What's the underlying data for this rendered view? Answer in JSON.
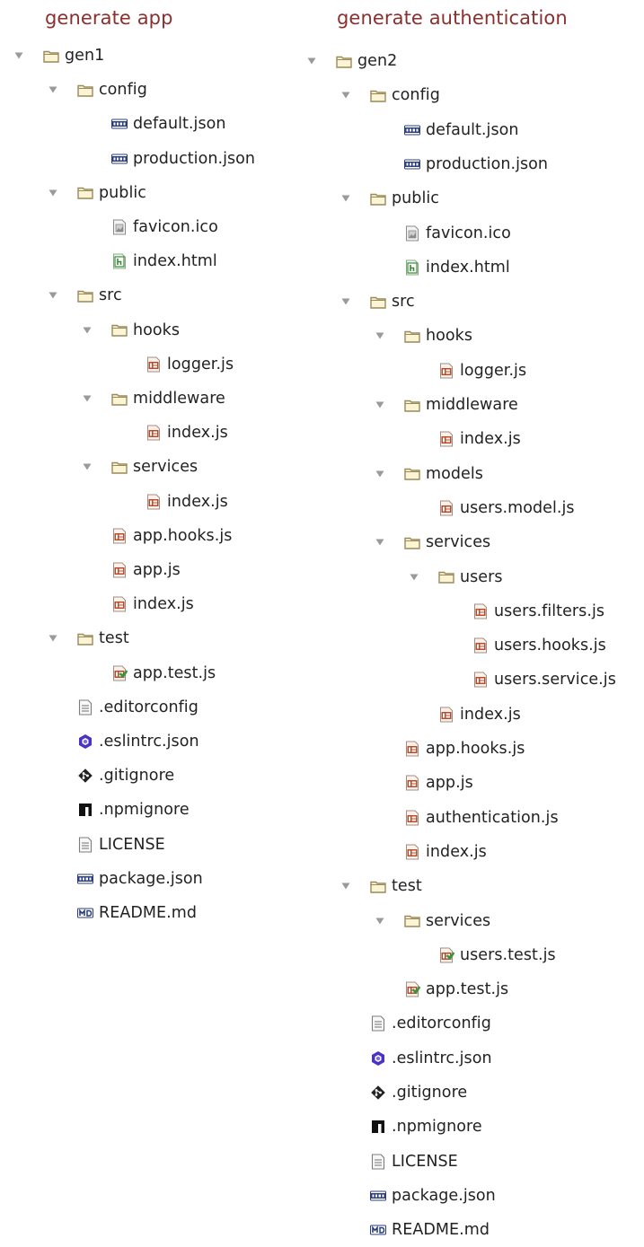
{
  "icons": {
    "twisty_open": "triangle-down-icon",
    "folder": "folder-icon",
    "json": "json-file-icon",
    "js": "js-file-icon",
    "js_test": "js-test-file-icon",
    "html": "html-file-icon",
    "ico": "image-file-icon",
    "text": "text-file-icon",
    "eslint": "eslint-icon",
    "git": "git-icon",
    "npm": "npm-icon",
    "md": "markdown-icon"
  },
  "colors": {
    "title": "#8b2f2f",
    "folder_border": "#9a8a5a",
    "folder_fill": "#fbf5d6",
    "twisty": "#9a9a9a",
    "json_badge": "#2c3f7a",
    "js_badge": "#b94a2a",
    "html_badge": "#3a8a3a",
    "eslint": "#4b32c3",
    "npm": "#111111",
    "md_badge": "#2c3f7a"
  },
  "panels": [
    {
      "title": "generate app",
      "rows": [
        {
          "label": "gen1",
          "icon": "folder",
          "depth": 0,
          "expanded": true
        },
        {
          "label": "config",
          "icon": "folder",
          "depth": 1,
          "expanded": true
        },
        {
          "label": "default.json",
          "icon": "json",
          "depth": 2
        },
        {
          "label": "production.json",
          "icon": "json",
          "depth": 2
        },
        {
          "label": "public",
          "icon": "folder",
          "depth": 1,
          "expanded": true
        },
        {
          "label": "favicon.ico",
          "icon": "ico",
          "depth": 2
        },
        {
          "label": "index.html",
          "icon": "html",
          "depth": 2
        },
        {
          "label": "src",
          "icon": "folder",
          "depth": 1,
          "expanded": true
        },
        {
          "label": "hooks",
          "icon": "folder",
          "depth": 2,
          "expanded": true
        },
        {
          "label": "logger.js",
          "icon": "js",
          "depth": 3
        },
        {
          "label": "middleware",
          "icon": "folder",
          "depth": 2,
          "expanded": true
        },
        {
          "label": "index.js",
          "icon": "js",
          "depth": 3
        },
        {
          "label": "services",
          "icon": "folder",
          "depth": 2,
          "expanded": true
        },
        {
          "label": "index.js",
          "icon": "js",
          "depth": 3
        },
        {
          "label": "app.hooks.js",
          "icon": "js",
          "depth": 2
        },
        {
          "label": "app.js",
          "icon": "js",
          "depth": 2
        },
        {
          "label": "index.js",
          "icon": "js",
          "depth": 2
        },
        {
          "label": "test",
          "icon": "folder",
          "depth": 1,
          "expanded": true
        },
        {
          "label": "app.test.js",
          "icon": "js_test",
          "depth": 2
        },
        {
          "label": ".editorconfig",
          "icon": "text",
          "depth": 1
        },
        {
          "label": ".eslintrc.json",
          "icon": "eslint",
          "depth": 1
        },
        {
          "label": ".gitignore",
          "icon": "git",
          "depth": 1
        },
        {
          "label": ".npmignore",
          "icon": "npm",
          "depth": 1
        },
        {
          "label": "LICENSE",
          "icon": "text",
          "depth": 1
        },
        {
          "label": "package.json",
          "icon": "json",
          "depth": 1
        },
        {
          "label": "README.md",
          "icon": "md",
          "depth": 1
        }
      ]
    },
    {
      "title": "generate authentication",
      "rows": [
        {
          "label": "gen2",
          "icon": "folder",
          "depth": 0,
          "expanded": true
        },
        {
          "label": "config",
          "icon": "folder",
          "depth": 1,
          "expanded": true
        },
        {
          "label": "default.json",
          "icon": "json",
          "depth": 2
        },
        {
          "label": "production.json",
          "icon": "json",
          "depth": 2
        },
        {
          "label": "public",
          "icon": "folder",
          "depth": 1,
          "expanded": true
        },
        {
          "label": "favicon.ico",
          "icon": "ico",
          "depth": 2
        },
        {
          "label": "index.html",
          "icon": "html",
          "depth": 2
        },
        {
          "label": "src",
          "icon": "folder",
          "depth": 1,
          "expanded": true
        },
        {
          "label": "hooks",
          "icon": "folder",
          "depth": 2,
          "expanded": true
        },
        {
          "label": "logger.js",
          "icon": "js",
          "depth": 3
        },
        {
          "label": "middleware",
          "icon": "folder",
          "depth": 2,
          "expanded": true
        },
        {
          "label": "index.js",
          "icon": "js",
          "depth": 3
        },
        {
          "label": "models",
          "icon": "folder",
          "depth": 2,
          "expanded": true
        },
        {
          "label": "users.model.js",
          "icon": "js",
          "depth": 3
        },
        {
          "label": "services",
          "icon": "folder",
          "depth": 2,
          "expanded": true
        },
        {
          "label": "users",
          "icon": "folder",
          "depth": 3,
          "expanded": true
        },
        {
          "label": "users.filters.js",
          "icon": "js",
          "depth": 4
        },
        {
          "label": "users.hooks.js",
          "icon": "js",
          "depth": 4
        },
        {
          "label": "users.service.js",
          "icon": "js",
          "depth": 4
        },
        {
          "label": "index.js",
          "icon": "js",
          "depth": 3
        },
        {
          "label": "app.hooks.js",
          "icon": "js",
          "depth": 2
        },
        {
          "label": "app.js",
          "icon": "js",
          "depth": 2
        },
        {
          "label": "authentication.js",
          "icon": "js",
          "depth": 2
        },
        {
          "label": "index.js",
          "icon": "js",
          "depth": 2
        },
        {
          "label": "test",
          "icon": "folder",
          "depth": 1,
          "expanded": true
        },
        {
          "label": "services",
          "icon": "folder",
          "depth": 2,
          "expanded": true
        },
        {
          "label": "users.test.js",
          "icon": "js_test",
          "depth": 3
        },
        {
          "label": "app.test.js",
          "icon": "js_test",
          "depth": 2
        },
        {
          "label": ".editorconfig",
          "icon": "text",
          "depth": 1
        },
        {
          "label": ".eslintrc.json",
          "icon": "eslint",
          "depth": 1
        },
        {
          "label": ".gitignore",
          "icon": "git",
          "depth": 1
        },
        {
          "label": ".npmignore",
          "icon": "npm",
          "depth": 1
        },
        {
          "label": "LICENSE",
          "icon": "text",
          "depth": 1
        },
        {
          "label": "package.json",
          "icon": "json",
          "depth": 1
        },
        {
          "label": "README.md",
          "icon": "md",
          "depth": 1
        }
      ]
    }
  ]
}
